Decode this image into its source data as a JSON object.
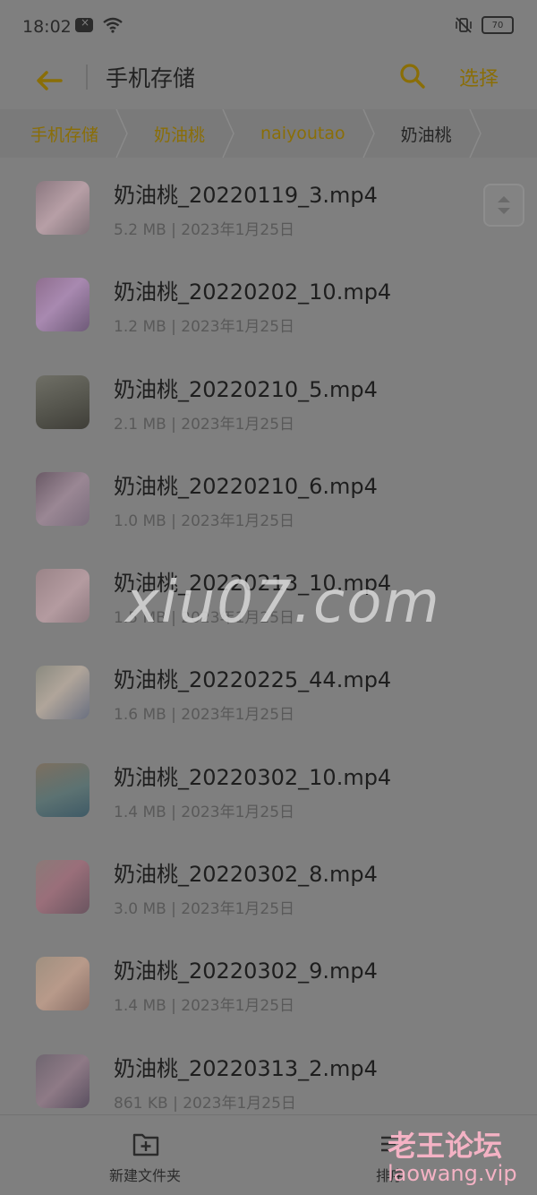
{
  "status_bar": {
    "time": "18:02",
    "battery": "70",
    "icons": [
      "notification-icon",
      "wifi-icon",
      "vibrate-off-icon",
      "battery-icon"
    ]
  },
  "top_bar": {
    "title": "手机存储",
    "select_label": "选择",
    "icons": [
      "back-arrow-icon",
      "search-icon"
    ],
    "accent_color": "#8a6e07"
  },
  "breadcrumb": [
    {
      "label": "手机存储"
    },
    {
      "label": "奶油桃"
    },
    {
      "label": "naiyoutao"
    },
    {
      "label": "奶油桃"
    }
  ],
  "files": [
    {
      "name": "奶油桃_20220119_3.mp4",
      "meta": "5.2 MB | 2023年1月25日"
    },
    {
      "name": "奶油桃_20220202_10.mp4",
      "meta": "1.2 MB | 2023年1月25日"
    },
    {
      "name": "奶油桃_20220210_5.mp4",
      "meta": "2.1 MB | 2023年1月25日"
    },
    {
      "name": "奶油桃_20220210_6.mp4",
      "meta": "1.0 MB | 2023年1月25日"
    },
    {
      "name": "奶油桃_20220213_10.mp4",
      "meta": "1.5 MB | 2023年1月25日"
    },
    {
      "name": "奶油桃_20220225_44.mp4",
      "meta": "1.6 MB | 2023年1月25日"
    },
    {
      "name": "奶油桃_20220302_10.mp4",
      "meta": "1.4 MB | 2023年1月25日"
    },
    {
      "name": "奶油桃_20220302_8.mp4",
      "meta": "3.0 MB | 2023年1月25日"
    },
    {
      "name": "奶油桃_20220302_9.mp4",
      "meta": "1.4 MB | 2023年1月25日"
    },
    {
      "name": "奶油桃_20220313_2.mp4",
      "meta": "861 KB | 2023年1月25日"
    }
  ],
  "watermark": "xiu07.com",
  "bottom_bar": {
    "new_folder_label": "新建文件夹",
    "sort_label": "排序"
  },
  "forum_watermark": {
    "title": "老王论坛",
    "url": "laowang.vip"
  }
}
